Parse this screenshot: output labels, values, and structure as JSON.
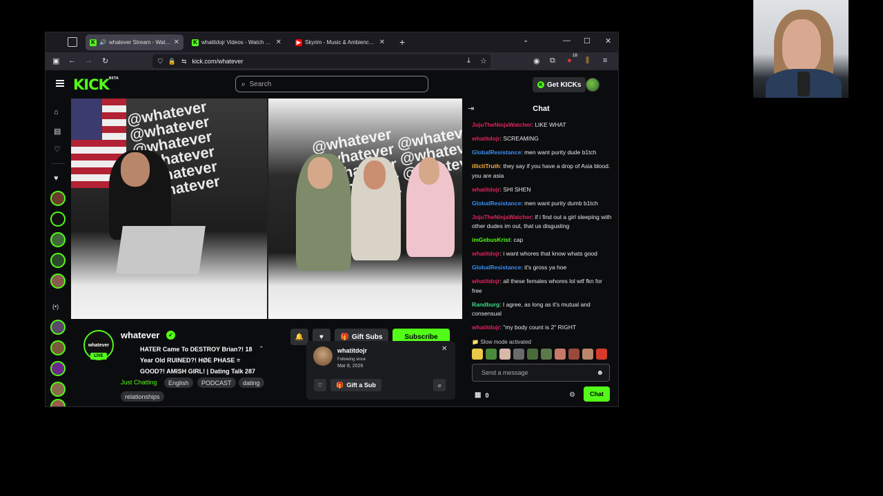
{
  "browser": {
    "tabs": [
      {
        "title": "whatever Stream - Watch Live",
        "icon": "kick",
        "active": true
      },
      {
        "title": "whatitdojr Videos - Watch On-Demand",
        "icon": "kick",
        "active": false
      },
      {
        "title": "Skyrim - Music & Ambience - N",
        "icon": "youtube",
        "active": false
      }
    ],
    "url": "kick.com/whatever",
    "ext_badge": "18"
  },
  "header": {
    "search_placeholder": "Search",
    "get_kicks_label": "Get KICKs",
    "logo_text": "KICK",
    "logo_sup": "BETA"
  },
  "channel": {
    "name": "whatever",
    "avatar_text": "whatever",
    "live_label": "LIVE",
    "title": "HATER Came To DESTROY Brian?! 18 Year Old RUINED?! HØE PHASE = GOOD?! AMISH GIRL! | Dating Talk 287",
    "category": "Just Chatting",
    "tags": [
      "English",
      "PODCAST",
      "dating",
      "relationships"
    ],
    "gift_subs_label": "Gift Subs",
    "subscribe_label": "Subscribe"
  },
  "popup": {
    "username": "whatitdojr",
    "following_since_label": "Following since",
    "following_date": "Mar 8, 2026",
    "gift_label": "Gift a Sub"
  },
  "chat": {
    "title": "Chat",
    "messages": [
      {
        "user": "JojuTheNinjaWatcher",
        "color": "#e0245e",
        "text": "LIKE WHAT"
      },
      {
        "user": "whatitdojr",
        "color": "#e0245e",
        "text": "SCREAMING"
      },
      {
        "user": "GlobalResistance",
        "color": "#3b8df2",
        "text": "men want purity dude b1tch"
      },
      {
        "user": "illicitTruth",
        "color": "#f5b042",
        "text": "they say if you have a drop of Asia blood. you are asia"
      },
      {
        "user": "whatitdojr",
        "color": "#e0245e",
        "text": "SHI SHEN"
      },
      {
        "user": "GlobalResistance",
        "color": "#3b8df2",
        "text": "men want purity dumb b1tch"
      },
      {
        "user": "JojuTheNinjaWatcher",
        "color": "#e0245e",
        "text": "if i find out a girl sleeping with other dudes im out, that us disgusting"
      },
      {
        "user": "imGebusKrist",
        "color": "#53fc18",
        "text": "cap"
      },
      {
        "user": "whatitdojr",
        "color": "#e0245e",
        "text": "i want whores that know whats good"
      },
      {
        "user": "GlobalResistance",
        "color": "#3b8df2",
        "text": "it's gross ya hoe"
      },
      {
        "user": "whatitdojr",
        "color": "#e0245e",
        "text": "all these females whores lol wtf fkn for free"
      },
      {
        "user": "Randburg",
        "color": "#3fd68a",
        "text": "I agree, as long as it's mutual and consensual"
      },
      {
        "user": "whatitdojr",
        "color": "#e0245e",
        "text": "\"my body count is 2\" RIGHT"
      }
    ],
    "slow_mode": "Slow mode activated",
    "input_placeholder": "Send a message",
    "kicks_count": "0",
    "send_label": "Chat"
  }
}
